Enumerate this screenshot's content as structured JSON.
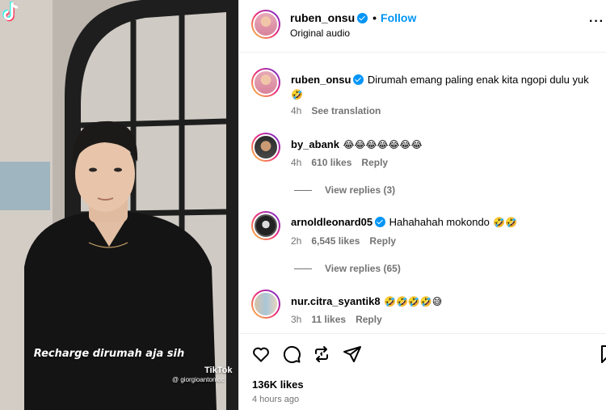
{
  "video": {
    "caption": "Recharge dirumah aja sih",
    "watermark_brand": "TikTok",
    "watermark_handle": "@ giorgioantonioc"
  },
  "post": {
    "username": "ruben_onsu",
    "follow_label": "Follow",
    "separator": "•",
    "audio": "Original audio",
    "more_icon": "more-horizontal-icon"
  },
  "caption_comment": {
    "username": "ruben_onsu",
    "text": "Dirumah emang paling enak kita ngopi dulu yuk",
    "emoji": "🤣",
    "time": "4h",
    "translate_label": "See translation"
  },
  "comments": [
    {
      "username": "by_abank",
      "text": "",
      "emoji": "😂😂😂😂😂😂😂",
      "time": "4h",
      "likes": "610 likes",
      "reply_label": "Reply",
      "view_replies": "View replies (3)"
    },
    {
      "username": "arnoldleonard05",
      "text": "Hahahahah mokondo",
      "emoji": "🤣🤣",
      "time": "2h",
      "likes": "6,545 likes",
      "reply_label": "Reply",
      "view_replies": "View replies (65)"
    },
    {
      "username": "nur.citra_syantik8",
      "text": "",
      "emoji": "🤣🤣🤣🤣😅",
      "time": "3h",
      "likes": "11 likes",
      "reply_label": "Reply",
      "view_replies": ""
    }
  ],
  "actions": {
    "icons": [
      "heart-icon",
      "comment-icon",
      "repost-icon",
      "share-icon",
      "bookmark-icon"
    ]
  },
  "stats": {
    "likes": "136K likes",
    "time_ago": "4 hours ago"
  },
  "colors": {
    "accent_blue": "#0095f6",
    "muted_text": "#737373",
    "divider": "#efefef"
  }
}
